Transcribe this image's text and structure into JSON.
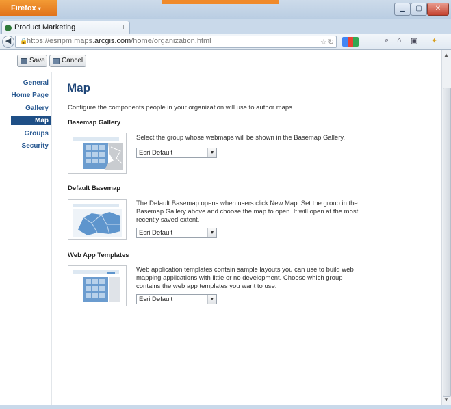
{
  "browser": {
    "app_button": "Firefox",
    "tab_title": "Product Marketing",
    "new_tab": "+",
    "url_plain_prefix": "https://esripm.maps.",
    "url_domain": "arcgis.com",
    "url_path": "/home/organization.html"
  },
  "toolbar": {
    "save_label": "Save",
    "cancel_label": "Cancel"
  },
  "sidebar": {
    "items": [
      {
        "label": "General"
      },
      {
        "label": "Home Page"
      },
      {
        "label": "Gallery"
      },
      {
        "label": "Map",
        "active": true
      },
      {
        "label": "Groups"
      },
      {
        "label": "Security"
      }
    ]
  },
  "main": {
    "title": "Map",
    "intro": "Configure the components people in your organization will use to author maps.",
    "sections": [
      {
        "heading": "Basemap Gallery",
        "description": "Select the group whose webmaps will be shown in the Basemap Gallery.",
        "selected": "Esri Default"
      },
      {
        "heading": "Default Basemap",
        "description": "The Default Basemap opens when users click New Map. Set the group in the Basemap Gallery above and choose the map to open. It will open at the most recently saved extent.",
        "selected": "Esri Default"
      },
      {
        "heading": "Web App Templates",
        "description": "Web application templates contain sample layouts you can use to build web mapping applications with little or no development. Choose which group contains the web app templates you want to use.",
        "selected": "Esri Default"
      }
    ]
  },
  "colors": {
    "accent": "#1f4f86",
    "heading": "#1f4678",
    "link": "#2a5a92",
    "firefox": "#e0711a"
  }
}
